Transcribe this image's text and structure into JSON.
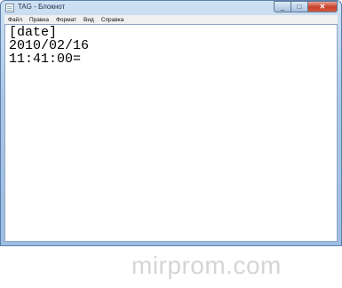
{
  "window": {
    "title": "TAG - Блокнот"
  },
  "menu": [
    "Файл",
    "Правка",
    "Формат",
    "Вид",
    "Справка"
  ],
  "editor": {
    "lines": [
      "[date]",
      "2010/02/16",
      "11:41:00="
    ]
  },
  "watermark": "mirprom.com"
}
